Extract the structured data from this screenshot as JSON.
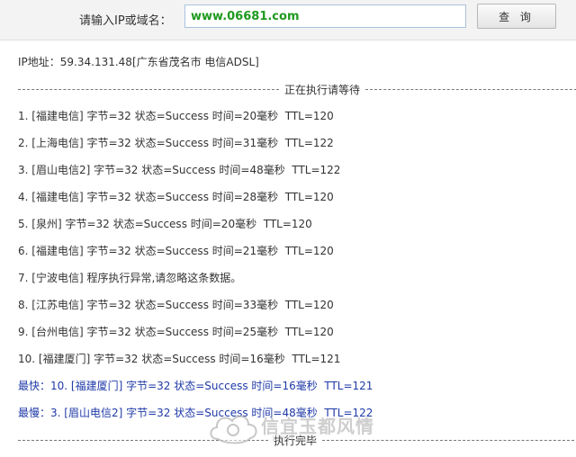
{
  "search": {
    "label": "请输入IP或域名：",
    "value": "www.06681.com",
    "button_label": "查 询"
  },
  "ip_info": {
    "label": "IP地址：",
    "value": "59.34.131.48[广东省茂名市 电信ADSL]"
  },
  "running_label": "正在执行请等待",
  "results": [
    {
      "text": "1. [福建电信] 字节=32 状态=Success 时间=20毫秒  TTL=120"
    },
    {
      "text": "2. [上海电信] 字节=32 状态=Success 时间=31毫秒  TTL=122"
    },
    {
      "text": "3. [眉山电信2] 字节=32 状态=Success 时间=48毫秒  TTL=122"
    },
    {
      "text": "4. [福建电信] 字节=32 状态=Success 时间=28毫秒  TTL=120"
    },
    {
      "text": "5. [泉州] 字节=32 状态=Success 时间=20毫秒  TTL=120"
    },
    {
      "text": "6. [福建电信] 字节=32 状态=Success 时间=21毫秒  TTL=120"
    },
    {
      "text": "7. [宁波电信] 程序执行异常,请忽略这条数据。"
    },
    {
      "text": "8. [江苏电信] 字节=32 状态=Success 时间=33毫秒  TTL=120"
    },
    {
      "text": "9. [台州电信] 字节=32 状态=Success 时间=25毫秒  TTL=120"
    },
    {
      "text": "10. [福建厦门] 字节=32 状态=Success 时间=16毫秒  TTL=121"
    }
  ],
  "fastest": "最快：10. [福建厦门] 字节=32 状态=Success 时间=16毫秒  TTL=121",
  "slowest": "最慢：3. [眉山电信2] 字节=32 状态=Success 时间=48毫秒  TTL=122",
  "done_label": "执行完毕",
  "watermark": {
    "text": "信宜玉都风情",
    "sub": "xinyi.ca"
  },
  "colors": {
    "input_text": "#1e9a1e",
    "summary_text": "#1f3aa8",
    "body_text": "#333333"
  }
}
